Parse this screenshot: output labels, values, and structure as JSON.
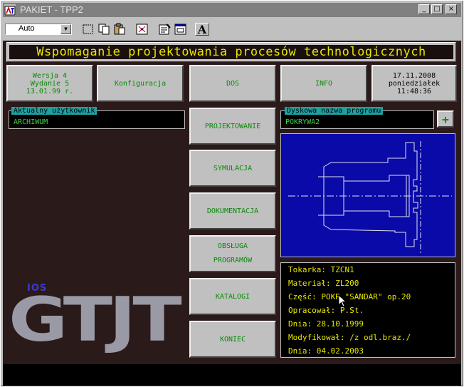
{
  "window": {
    "title": "PAKIET - TPP2",
    "minimize_label": "_",
    "maximize_label": "□",
    "close_label": "×"
  },
  "toolbar": {
    "zoom_value": "Auto",
    "font_button_label": "A"
  },
  "banner": {
    "text": "Wspomaganie projektowania procesów technologicznych"
  },
  "top_buttons": {
    "version_lines": [
      "Wersja 4",
      "Wydanie 5",
      "13.01.99 r."
    ],
    "config": "Konfiguracja",
    "dos": "DOS",
    "info": "INFO",
    "datetime_lines": [
      "17.11.2008",
      "poniedziałek",
      "11:48:36"
    ]
  },
  "user": {
    "label": "Aktualny użytkownik",
    "value": "ARCHIWUM"
  },
  "program": {
    "label": "Dyskowa nazwa programu",
    "value": "POKRYWA2",
    "add_label": "+"
  },
  "menu": {
    "design": "PROJEKTOWANIE",
    "simulation": "SYMULACJA",
    "documentation": "DOKUMENTACJA",
    "service_lines": [
      "OBSŁUGA",
      "PROGRAMÓW"
    ],
    "catalogs": "KATALOGI",
    "end": "KONIEC"
  },
  "details": {
    "lathe": "Tokarka: TZCN1",
    "material": "Materiał: ZL200",
    "part": "Część: POKR.\"SANDAR\" op.20",
    "author": "Opracował: P.St.",
    "date1": "Dnia: 28.10.1999",
    "modified": "Modyfikował: /z odl.braz./",
    "date2": "Dnia: 04.02.2003"
  },
  "logo": {
    "small": "IOS",
    "large": "GTJT"
  },
  "colors": {
    "panel_bg": "#2b1a1a",
    "banner_text": "#e6e600",
    "button_text": "#0a8a0a",
    "label_bg": "#1fa0a0",
    "drawing_bg": "#0a0aa8"
  }
}
